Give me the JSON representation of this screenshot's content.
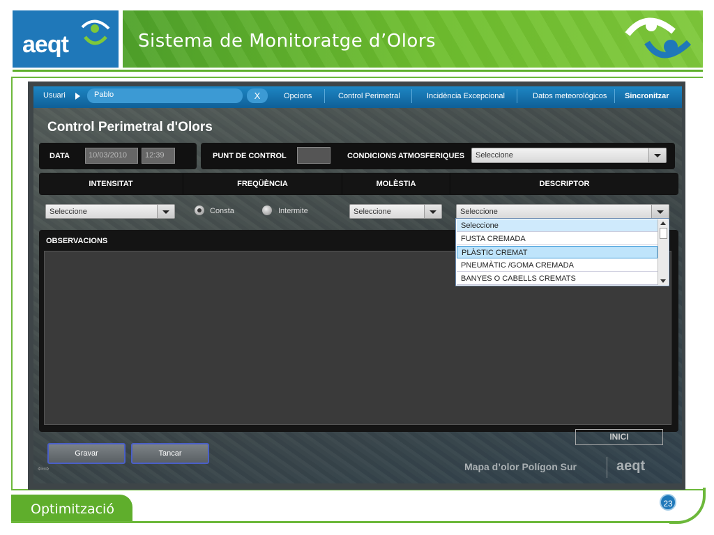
{
  "slide": {
    "title": "Sistema de Monitoratge d’Olors",
    "footer": "Optimització",
    "page_number": "23",
    "logo_text": "aeqt"
  },
  "topbar": {
    "user_label": "Usuari",
    "user_value": "Pablo",
    "close_label": "X",
    "menu": [
      "Opcions",
      "Control Perimetral",
      "Incidència Excepcional",
      "Datos meteorológicos",
      "Sincronitzar"
    ]
  },
  "form": {
    "title": "Control Perimetral d'Olors",
    "data_label": "DATA",
    "date_value": "10/03/2010",
    "time_value": "12:39",
    "punt_label": "PUNT DE CONTROL",
    "cond_label": "CONDICIONS ATMOSFERIQUES",
    "cond_select": "Seleccione",
    "headers": [
      "INTENSITAT",
      "FREQÜÈNCIA",
      "MOLÈSTIA",
      "DESCRIPTOR"
    ],
    "intensitat_select": "Seleccione",
    "freq_option1": "Consta",
    "freq_option2": "Intermite",
    "molestia_select": "Seleccione",
    "descriptor_select": "Seleccione",
    "obs_label": "OBSERVACIONS",
    "save_label": "Gravar",
    "close_label": "Tancar"
  },
  "dropdown": {
    "items": [
      "Seleccione",
      "FUSTA CREMADA",
      "PLÀSTIC CREMAT",
      "PNEUMÀTIC /GOMA CREMADA",
      "BANYES O CABELLS CREMATS"
    ],
    "selected_index": 2
  },
  "map": {
    "label": "Mapa d’olor Polígon Sur",
    "inici_label": "INICI",
    "logo_text": "aeqt"
  },
  "colors": {
    "brand_blue": "#1f78b9",
    "brand_green": "#5fae2c",
    "topbar_blue": "#1a7fc0"
  }
}
